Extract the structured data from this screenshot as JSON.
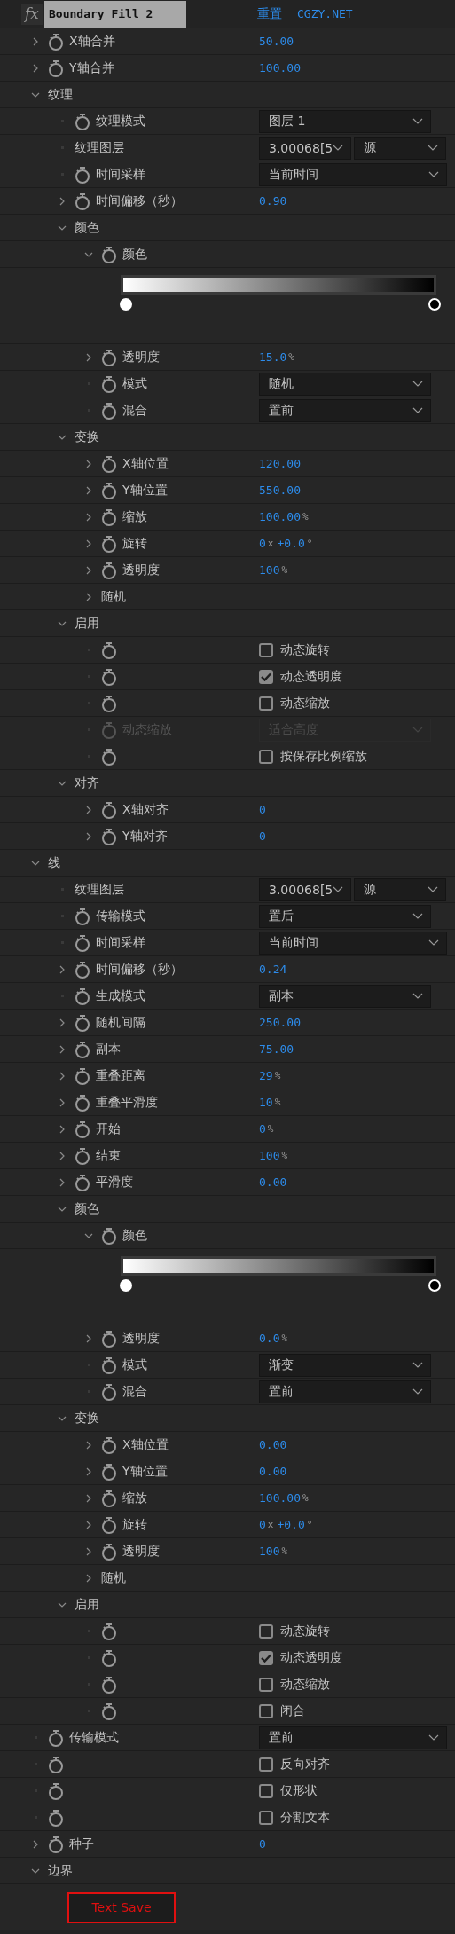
{
  "effect": {
    "icon": "fx",
    "title": "Boundary Fill 2",
    "reset": "重置",
    "about": "CGZY.NET"
  },
  "properties": [
    {
      "label": "X轴合并",
      "kind": "number",
      "expanded": false,
      "stopwatch": true,
      "value": "50.00"
    },
    {
      "label": "Y轴合并",
      "kind": "number",
      "expanded": false,
      "stopwatch": true,
      "value": "100.00"
    },
    {
      "label": "纹理",
      "kind": "group",
      "expanded": true,
      "children": [
        {
          "label": "纹理模式",
          "kind": "dropdown",
          "stopwatch": true,
          "value": "图层 1"
        },
        {
          "label": "纹理图层",
          "kind": "layers",
          "value": "3.00068[5",
          "source": "源"
        },
        {
          "label": "时间采样",
          "kind": "dropdown",
          "stopwatch": true,
          "value": "当前时间",
          "wide": true
        },
        {
          "label": "时间偏移（秒）",
          "kind": "number",
          "expanded": false,
          "stopwatch": true,
          "value": "0.90"
        },
        {
          "label": "颜色",
          "kind": "group",
          "expanded": true,
          "children": [
            {
              "label": "颜色",
              "kind": "gradient",
              "expanded": true,
              "stopwatch": true,
              "stops": [
                {
                  "color": "#ffffff"
                },
                {
                  "color": "#000000"
                }
              ]
            },
            {
              "label": "透明度",
              "kind": "number",
              "expanded": false,
              "stopwatch": true,
              "value": "15.0",
              "unit": "%"
            },
            {
              "label": "模式",
              "kind": "dropdown",
              "stopwatch": true,
              "value": "随机"
            },
            {
              "label": "混合",
              "kind": "dropdown",
              "stopwatch": true,
              "value": "置前"
            }
          ]
        },
        {
          "label": "变换",
          "kind": "group",
          "expanded": true,
          "children": [
            {
              "label": "X轴位置",
              "kind": "number",
              "expanded": false,
              "stopwatch": true,
              "value": "120.00"
            },
            {
              "label": "Y轴位置",
              "kind": "number",
              "expanded": false,
              "stopwatch": true,
              "value": "550.00"
            },
            {
              "label": "缩放",
              "kind": "number",
              "expanded": false,
              "stopwatch": true,
              "value": "100.00",
              "unit": "%"
            },
            {
              "label": "旋转",
              "kind": "number",
              "expanded": false,
              "stopwatch": true,
              "turns": "0",
              "turns_unit": "x",
              "value": "+0.0",
              "unit": "°"
            },
            {
              "label": "透明度",
              "kind": "number",
              "expanded": false,
              "stopwatch": true,
              "value": "100",
              "unit": "%"
            },
            {
              "label": "随机",
              "kind": "group",
              "expanded": false
            }
          ]
        },
        {
          "label": "启用",
          "kind": "group",
          "expanded": true,
          "children": [
            {
              "kind": "checkbox",
              "stopwatch": true,
              "text": "动态旋转",
              "checked": false,
              "disabled": false
            },
            {
              "kind": "checkbox",
              "stopwatch": true,
              "text": "动态透明度",
              "checked": true,
              "disabled": false
            },
            {
              "kind": "checkbox",
              "stopwatch": true,
              "text": "动态缩放",
              "checked": false,
              "disabled": false
            },
            {
              "label": "动态缩放",
              "kind": "dropdown",
              "stopwatch": true,
              "value": "适合高度",
              "disabled": true
            },
            {
              "kind": "checkbox",
              "stopwatch": true,
              "text": "按保存比例缩放",
              "checked": false,
              "disabled": false
            }
          ]
        },
        {
          "label": "对齐",
          "kind": "group",
          "expanded": true,
          "children": [
            {
              "label": "X轴对齐",
              "kind": "number",
              "expanded": false,
              "stopwatch": true,
              "value": "0"
            },
            {
              "label": "Y轴对齐",
              "kind": "number",
              "expanded": false,
              "stopwatch": true,
              "value": "0"
            }
          ]
        }
      ]
    },
    {
      "label": "线",
      "kind": "group",
      "expanded": true,
      "children": [
        {
          "label": "纹理图层",
          "kind": "layers",
          "value": "3.00068[5",
          "source": "源"
        },
        {
          "label": "传输模式",
          "kind": "dropdown",
          "stopwatch": true,
          "value": "置后"
        },
        {
          "label": "时间采样",
          "kind": "dropdown",
          "stopwatch": true,
          "value": "当前时间",
          "wide": true
        },
        {
          "label": "时间偏移（秒）",
          "kind": "number",
          "expanded": false,
          "stopwatch": true,
          "value": "0.24"
        },
        {
          "label": "生成模式",
          "kind": "dropdown",
          "stopwatch": true,
          "value": "副本"
        },
        {
          "label": "随机间隔",
          "kind": "number",
          "expanded": false,
          "stopwatch": true,
          "value": "250.00"
        },
        {
          "label": "副本",
          "kind": "number",
          "expanded": false,
          "stopwatch": true,
          "value": "75.00"
        },
        {
          "label": "重叠距离",
          "kind": "number",
          "expanded": false,
          "stopwatch": true,
          "value": "29",
          "unit": "%"
        },
        {
          "label": "重叠平滑度",
          "kind": "number",
          "expanded": false,
          "stopwatch": true,
          "value": "10",
          "unit": "%"
        },
        {
          "label": "开始",
          "kind": "number",
          "expanded": false,
          "stopwatch": true,
          "value": "0",
          "unit": "%"
        },
        {
          "label": "结束",
          "kind": "number",
          "expanded": false,
          "stopwatch": true,
          "value": "100",
          "unit": "%"
        },
        {
          "label": "平滑度",
          "kind": "number",
          "expanded": false,
          "stopwatch": true,
          "value": "0.00"
        },
        {
          "label": "颜色",
          "kind": "group",
          "expanded": true,
          "children": [
            {
              "label": "颜色",
              "kind": "gradient",
              "expanded": true,
              "stopwatch": true,
              "stops": [
                {
                  "color": "#ffffff"
                },
                {
                  "color": "#000000"
                }
              ]
            },
            {
              "label": "透明度",
              "kind": "number",
              "expanded": false,
              "stopwatch": true,
              "value": "0.0",
              "unit": "%"
            },
            {
              "label": "模式",
              "kind": "dropdown",
              "stopwatch": true,
              "value": "渐变"
            },
            {
              "label": "混合",
              "kind": "dropdown",
              "stopwatch": true,
              "value": "置前"
            }
          ]
        },
        {
          "label": "变换",
          "kind": "group",
          "expanded": true,
          "children": [
            {
              "label": "X轴位置",
              "kind": "number",
              "expanded": false,
              "stopwatch": true,
              "value": "0.00"
            },
            {
              "label": "Y轴位置",
              "kind": "number",
              "expanded": false,
              "stopwatch": true,
              "value": "0.00"
            },
            {
              "label": "缩放",
              "kind": "number",
              "expanded": false,
              "stopwatch": true,
              "value": "100.00",
              "unit": "%"
            },
            {
              "label": "旋转",
              "kind": "number",
              "expanded": false,
              "stopwatch": true,
              "turns": "0",
              "turns_unit": "x",
              "value": "+0.0",
              "unit": "°"
            },
            {
              "label": "透明度",
              "kind": "number",
              "expanded": false,
              "stopwatch": true,
              "value": "100",
              "unit": "%"
            },
            {
              "label": "随机",
              "kind": "group",
              "expanded": false
            }
          ]
        },
        {
          "label": "启用",
          "kind": "group",
          "expanded": true,
          "children": [
            {
              "kind": "checkbox",
              "stopwatch": true,
              "text": "动态旋转",
              "checked": false,
              "disabled": false
            },
            {
              "kind": "checkbox",
              "stopwatch": true,
              "text": "动态透明度",
              "checked": true,
              "disabled": false
            },
            {
              "kind": "checkbox",
              "stopwatch": true,
              "text": "动态缩放",
              "checked": false,
              "disabled": false
            },
            {
              "kind": "checkbox",
              "stopwatch": true,
              "text": "闭合",
              "checked": false,
              "disabled": false
            }
          ]
        }
      ]
    },
    {
      "label": "传输模式",
      "kind": "dropdown",
      "stopwatch": true,
      "value": "置前",
      "wide": true
    },
    {
      "kind": "checkbox",
      "stopwatch": true,
      "text": "反向对齐",
      "checked": false
    },
    {
      "kind": "checkbox",
      "stopwatch": true,
      "text": "仅形状",
      "checked": false
    },
    {
      "kind": "checkbox",
      "stopwatch": true,
      "text": "分割文本",
      "checked": false
    },
    {
      "label": "种子",
      "kind": "number",
      "expanded": false,
      "stopwatch": true,
      "value": "0"
    },
    {
      "label": "边界",
      "kind": "group",
      "expanded": true,
      "children": [
        {
          "kind": "button",
          "text": "Text Save"
        }
      ]
    }
  ]
}
